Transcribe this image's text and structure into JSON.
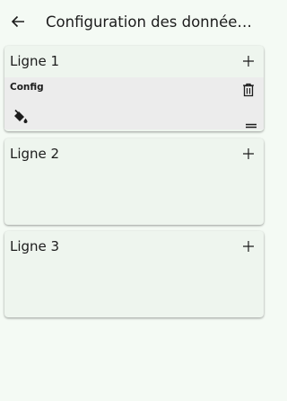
{
  "appbar": {
    "title": "Configuration des données te...",
    "back_icon": "arrow-back-icon"
  },
  "lines": [
    {
      "label": "Ligne 1",
      "add_icon": "plus-icon",
      "config": {
        "label": "Config",
        "delete_icon": "trash-icon",
        "color_icon": "paint-bucket-icon",
        "drag_icon": "drag-handle-icon"
      }
    },
    {
      "label": "Ligne 2",
      "add_icon": "plus-icon"
    },
    {
      "label": "Ligne 3",
      "add_icon": "plus-icon"
    }
  ],
  "colors": {
    "background": "#f4faf4",
    "card": "#eef5ee",
    "config_row": "#ececec",
    "text": "#1c1c1c"
  }
}
